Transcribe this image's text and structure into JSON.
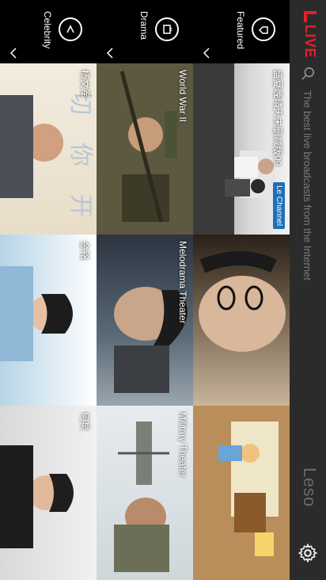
{
  "app": {
    "logo_text": "LIVE",
    "brand": "Leso"
  },
  "search": {
    "placeholder": "The best live broadcasts from the Internet"
  },
  "sidebar": [
    {
      "label": "Featured",
      "icon": "tag-icon"
    },
    {
      "label": "Drama",
      "icon": "tv-icon"
    },
    {
      "label": "Celebrity",
      "icon": "v-badge-icon"
    }
  ],
  "featured_row": [
    {
      "caption": "盛夏晚晴天未删减版09",
      "badge": "Le Channel"
    },
    {
      "caption": ""
    },
    {
      "caption": ""
    }
  ],
  "drama_row": [
    {
      "caption": "World War II"
    },
    {
      "caption": "Melodrama Theater"
    },
    {
      "caption": "Military Theater"
    }
  ],
  "celebrity_row": [
    {
      "caption": "杨文军"
    },
    {
      "caption": "金铭"
    },
    {
      "caption": "何炅"
    }
  ]
}
